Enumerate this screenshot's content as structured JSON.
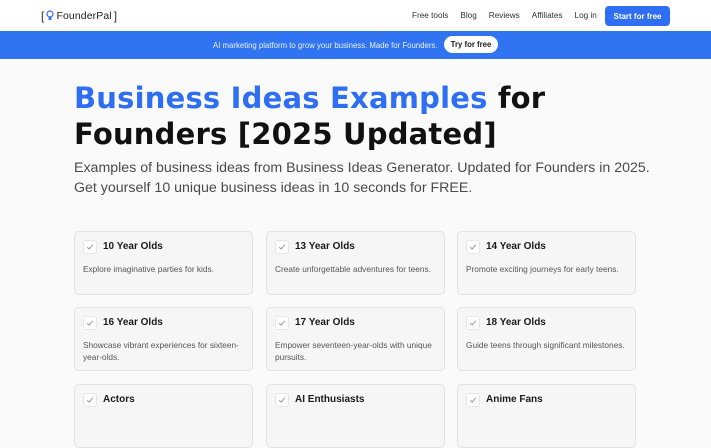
{
  "brand": {
    "name": "FounderPal"
  },
  "nav": {
    "links": [
      "Free tools",
      "Blog",
      "Reviews",
      "Affiliates",
      "Log in"
    ],
    "cta": "Start for free"
  },
  "banner": {
    "text": "AI marketing platform to grow your business. Made for Founders.",
    "button": "Try for free"
  },
  "hero": {
    "title_accent": "Business Ideas Examples",
    "title_rest": "for Founders [2025 Updated]",
    "subtitle": "Examples of business ideas from Business Ideas Generator. Updated for Founders in 2025. Get yourself 10 unique business ideas in 10 seconds for FREE."
  },
  "cards": [
    {
      "title": "10 Year Olds",
      "desc": "Explore imaginative parties for kids."
    },
    {
      "title": "13 Year Olds",
      "desc": "Create unforgettable adventures for teens."
    },
    {
      "title": "14 Year Olds",
      "desc": "Promote exciting journeys for early teens."
    },
    {
      "title": "16 Year Olds",
      "desc": "Showcase vibrant experiences for sixteen-year-olds."
    },
    {
      "title": "17 Year Olds",
      "desc": "Empower seventeen-year-olds with unique pursuits."
    },
    {
      "title": "18 Year Olds",
      "desc": "Guide teens through significant milestones."
    },
    {
      "title": "Actors",
      "desc": ""
    },
    {
      "title": "AI Enthusiasts",
      "desc": ""
    },
    {
      "title": "Anime Fans",
      "desc": ""
    }
  ],
  "colors": {
    "accent": "#2e6ef2",
    "banner": "#3074f2"
  }
}
